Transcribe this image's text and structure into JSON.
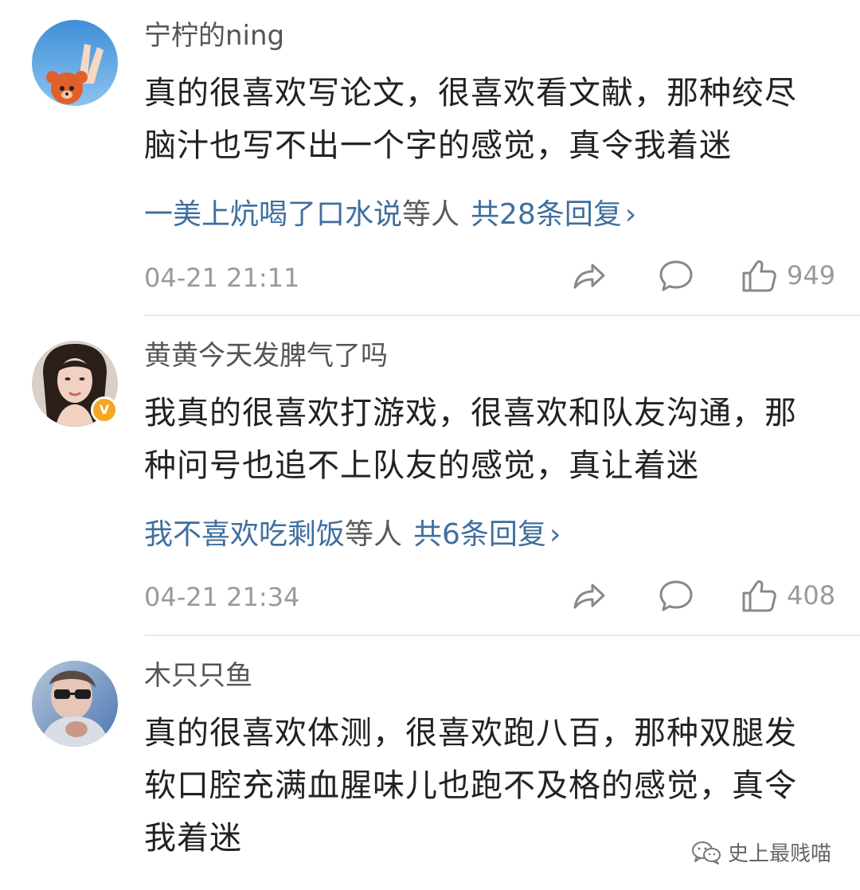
{
  "comments": [
    {
      "username": "宁柠的ning",
      "content_lines": [
        "真的很喜欢写论文，很喜欢看文献，那种绞尽",
        "脑汁也写不出一个字的感觉，真令我着迷"
      ],
      "reply_users": "一美上炕喝了口水说",
      "reply_mid": "等人",
      "reply_count": "共28条回复",
      "reply_chevron": "›",
      "time": "04-21 21:11",
      "likes": "949",
      "avatar_icon": "avatar-hand-bear"
    },
    {
      "username": "黄黄今天发脾气了吗",
      "content_lines": [
        "我真的很喜欢打游戏，很喜欢和队友沟通，那",
        "种问号也追不上队友的感觉，真让着迷"
      ],
      "reply_users": "我不喜欢吃剩饭",
      "reply_mid": "等人",
      "reply_count": "共6条回复",
      "reply_chevron": "›",
      "time": "04-21 21:34",
      "likes": "408",
      "verified_badge": "V",
      "avatar_icon": "avatar-woman"
    },
    {
      "username": "木只只鱼",
      "content_lines": [
        "真的很喜欢体测，很喜欢跑八百，那种双腿发",
        "软口腔充满血腥味儿也跑不及格的感觉，真令",
        "我着迷"
      ],
      "avatar_icon": "avatar-sunglasses"
    }
  ],
  "icons": {
    "share": "share-icon",
    "comment": "comment-icon",
    "like": "thumbs-up-icon"
  },
  "watermark": {
    "text": "史上最贱喵",
    "icon": "wechat-icon"
  },
  "colors": {
    "link": "#3f6f9e",
    "meta": "#9a9a9a",
    "text": "#222222",
    "verified": "#f5a623"
  }
}
